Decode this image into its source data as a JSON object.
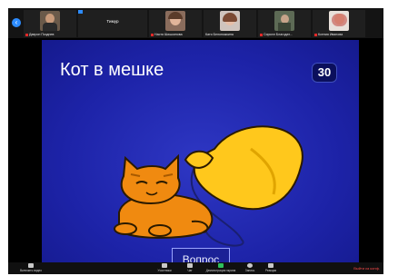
{
  "participants": {
    "nav_prev_icon": "chevron-left",
    "tiles": [
      {
        "name": "Даврон Позднев",
        "has_video": true
      },
      {
        "name": "Тимур",
        "has_video": false
      },
      {
        "name": "Настя Шишкинова",
        "has_video": true
      },
      {
        "name": "Катя Белоножкина",
        "has_video": true
      },
      {
        "name": "Сирилл Благодат...",
        "has_video": true
      },
      {
        "name": "Ксения Иванова",
        "has_video": true
      }
    ]
  },
  "slide": {
    "title": "Кот в мешке",
    "points": "30",
    "question_label": "Вопрос"
  },
  "toolbar": {
    "items": [
      {
        "label": "Включить видео",
        "icon": "video-icon"
      },
      {
        "label": "Участники",
        "icon": "participants-icon",
        "count": "20"
      },
      {
        "label": "Чат",
        "icon": "chat-icon"
      },
      {
        "label": "Демонстрация экрана",
        "icon": "share-screen-icon"
      },
      {
        "label": "Запись",
        "icon": "record-icon"
      },
      {
        "label": "Реакции",
        "icon": "reactions-icon"
      }
    ],
    "end_label": "Выйти из конф."
  },
  "colors": {
    "slide_bg": "#1d23a8",
    "bag": "#ffc81c",
    "cat": "#f08a10",
    "zoom_blue": "#2d8cff"
  }
}
